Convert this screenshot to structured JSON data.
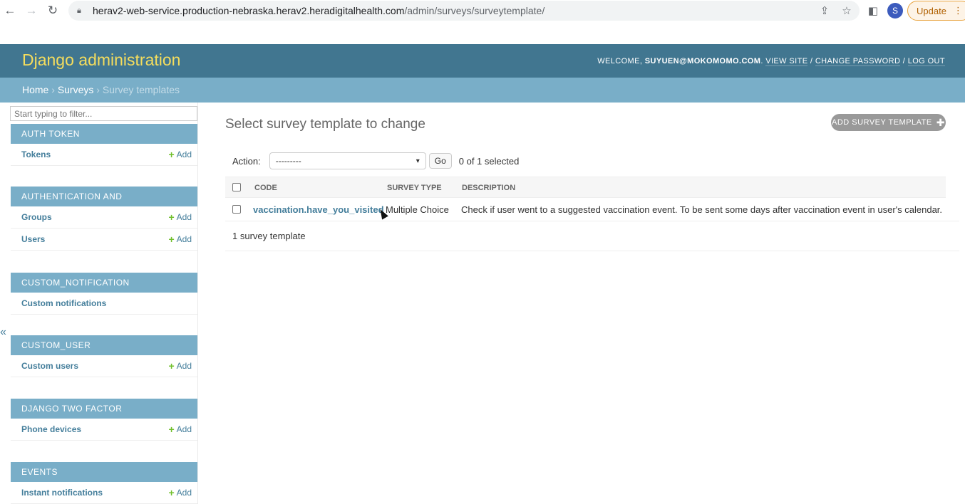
{
  "browser": {
    "url_host": "herav2-web-service.production-nebraska.herav2.heradigitalhealth.com",
    "url_path": "/admin/surveys/surveytemplate/",
    "avatar_letter": "S",
    "update_label": "Update"
  },
  "header": {
    "branding": "Django administration",
    "welcome_label": "WELCOME,",
    "username": "SUYUEN@MOKOMOMO.COM",
    "view_site": "VIEW SITE",
    "change_password": "CHANGE PASSWORD",
    "log_out": "LOG OUT"
  },
  "breadcrumbs": {
    "home": "Home",
    "surveys": "Surveys",
    "current": "Survey templates"
  },
  "sidebar": {
    "filter_placeholder": "Start typing to filter...",
    "add_label": "Add",
    "modules": [
      {
        "title": "AUTH TOKEN",
        "models": [
          {
            "name": "Tokens",
            "add": true
          }
        ]
      },
      {
        "title": "AUTHENTICATION AND AUTHORIZATION",
        "models": [
          {
            "name": "Groups",
            "add": true
          },
          {
            "name": "Users",
            "add": true
          }
        ]
      },
      {
        "title": "CUSTOM_NOTIFICATION",
        "models": [
          {
            "name": "Custom notifications",
            "add": false
          }
        ]
      },
      {
        "title": "CUSTOM_USER",
        "models": [
          {
            "name": "Custom users",
            "add": true
          }
        ]
      },
      {
        "title": "DJANGO TWO FACTOR AUTHENTICATION",
        "models": [
          {
            "name": "Phone devices",
            "add": true
          }
        ]
      },
      {
        "title": "EVENTS",
        "models": [
          {
            "name": "Instant notifications",
            "add": true
          }
        ]
      }
    ]
  },
  "content": {
    "title": "Select survey template to change",
    "add_button": "ADD SURVEY TEMPLATE",
    "action_label": "Action:",
    "action_value": "---------",
    "go_label": "Go",
    "selected_count": "0 of 1 selected",
    "columns": [
      "CODE",
      "SURVEY TYPE",
      "DESCRIPTION"
    ],
    "rows": [
      {
        "code": "vaccination.have_you_visited",
        "survey_type": "Multiple Choice",
        "description": "Check if user went to a suggested vaccination event. To be sent some days after vaccination event in user's calendar."
      }
    ],
    "paginator": "1 survey template"
  }
}
